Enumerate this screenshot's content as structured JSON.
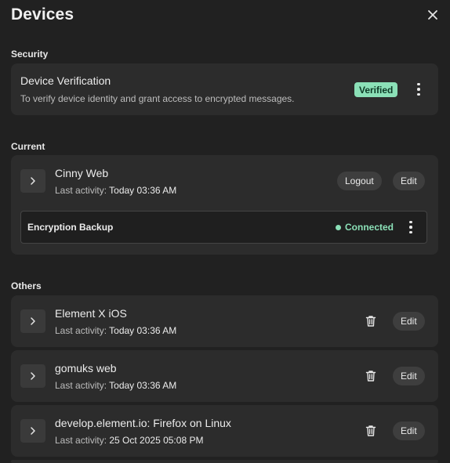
{
  "header": {
    "title": "Devices"
  },
  "security": {
    "section_label": "Security",
    "title": "Device Verification",
    "description": "To verify device identity and grant access to encrypted messages.",
    "badge": "Verified",
    "badge_color": "#8be0b7"
  },
  "current": {
    "section_label": "Current",
    "device": {
      "name": "Cinny Web",
      "activity_label": "Last activity:",
      "activity_value": "Today 03:36 AM",
      "logout_label": "Logout",
      "edit_label": "Edit"
    },
    "backup": {
      "label": "Encryption Backup",
      "status": "Connected",
      "status_color": "#8be0b7"
    }
  },
  "others": {
    "section_label": "Others",
    "devices": [
      {
        "name": "Element X iOS",
        "activity_label": "Last activity:",
        "activity_value": "Today 03:36 AM",
        "edit_label": "Edit"
      },
      {
        "name": "gomuks web",
        "activity_label": "Last activity:",
        "activity_value": "Today 03:36 AM",
        "edit_label": "Edit"
      },
      {
        "name": "develop.element.io: Firefox on Linux",
        "activity_label": "Last activity:",
        "activity_value": "25 Oct 2025 05:08 PM",
        "edit_label": "Edit"
      }
    ]
  },
  "icons": {
    "close": "close-icon",
    "more": "more-vertical-icon",
    "expand": "chevron-right-icon",
    "delete": "trash-icon"
  }
}
